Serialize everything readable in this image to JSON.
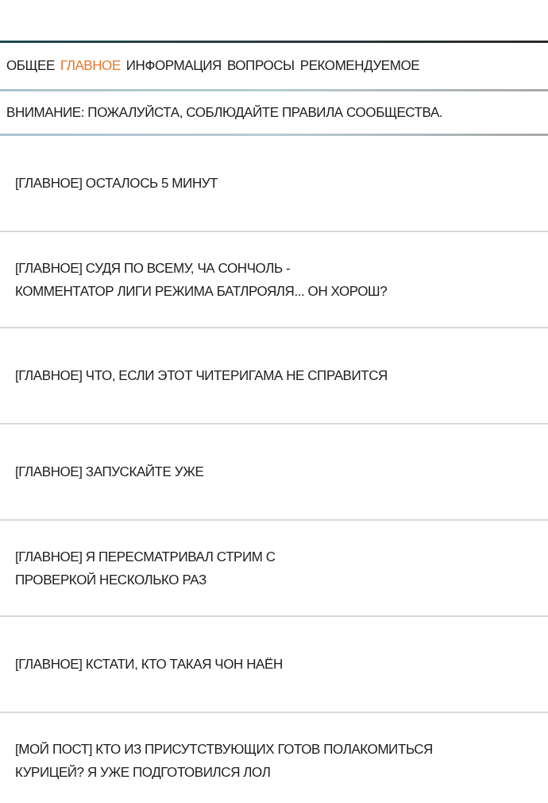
{
  "tabs": [
    {
      "label": "ОБЩЕЕ",
      "selected": false
    },
    {
      "label": "ГЛАВНОЕ",
      "selected": true
    },
    {
      "label": "ИНФОРМАЦИЯ",
      "selected": false
    },
    {
      "label": "ВОПРОСЫ",
      "selected": false
    },
    {
      "label": "РЕКОМЕНДУЕМОЕ",
      "selected": false
    }
  ],
  "notice": "ВНИМАНИЕ: ПОЖАЛУЙСТА, СОБЛЮДАЙТЕ ПРАВИЛА СООБЩЕСТВА.",
  "posts": [
    {
      "lines": [
        "[ГЛАВНОЕ] ОСТАЛОСЬ 5 МИНУТ"
      ]
    },
    {
      "lines": [
        "[ГЛАВНОЕ] СУДЯ ПО ВСЕМУ, ЧА СОНЧОЛЬ -",
        "КОММЕНТАТОР ЛИГИ РЕЖИМА БАТЛРОЯЛЯ... ОН ХОРОШ?"
      ]
    },
    {
      "lines": [
        "[ГЛАВНОЕ] ЧТО, ЕСЛИ ЭТОТ ЧИТЕРИГАМА НЕ СПРАВИТСЯ"
      ]
    },
    {
      "lines": [
        "[ГЛАВНОЕ] ЗАПУСКАЙТЕ УЖЕ"
      ]
    },
    {
      "lines": [
        "[ГЛАВНОЕ] Я ПЕРЕСМАТРИВАЛ СТРИМ С",
        "ПРОВЕРКОЙ НЕСКОЛЬКО РАЗ"
      ]
    },
    {
      "lines": [
        "[ГЛАВНОЕ] КСТАТИ, КТО ТАКАЯ ЧОН НАЁН"
      ]
    },
    {
      "lines": [
        "[МОЙ ПОСТ] КТО ИЗ ПРИСУТСТВУЮЩИХ ГОТОВ ПОЛАКОМИТЬСЯ",
        "КУРИЦЕЙ? Я УЖЕ ПОДГОТОВИЛСЯ ЛОЛ"
      ]
    }
  ]
}
